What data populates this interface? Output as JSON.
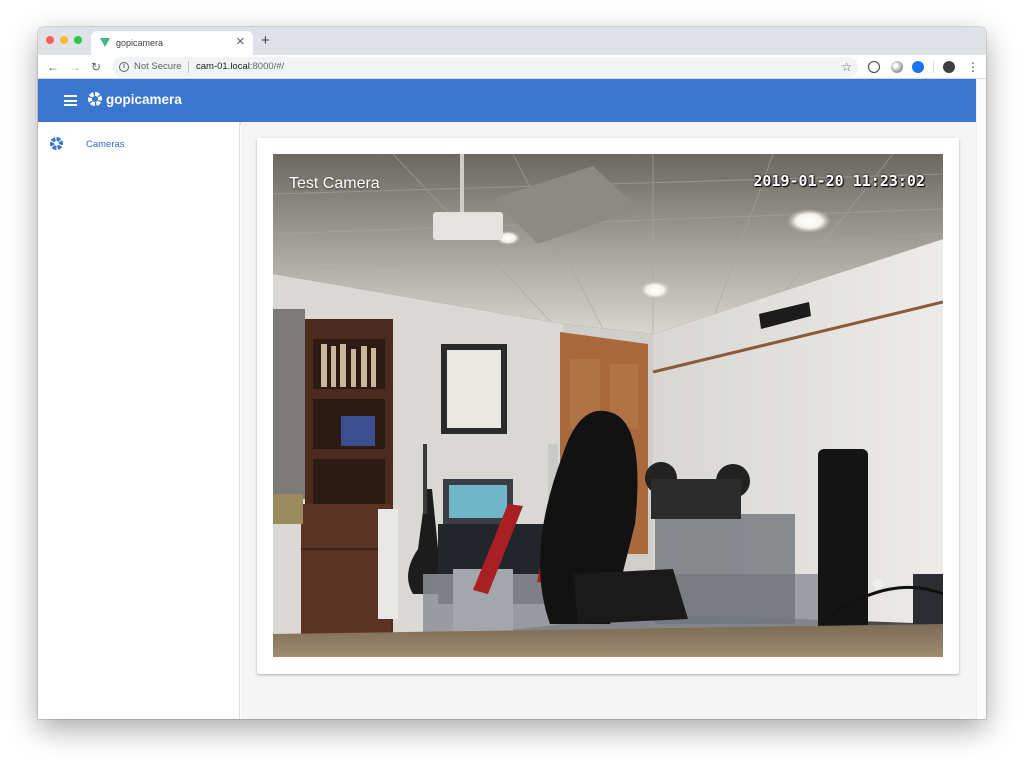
{
  "browser": {
    "tab_title": "gopicamera",
    "tab_favicon": "vue-logo-icon",
    "security_label": "Not Secure",
    "url_host": "cam-01.local",
    "url_rest": ":8000/#/"
  },
  "app": {
    "title": "gopicamera",
    "accent_color": "#3a76cf"
  },
  "sidebar": {
    "items": [
      {
        "label": "Cameras",
        "icon": "camera-aperture-icon"
      }
    ]
  },
  "main": {
    "camera": {
      "name": "Test Camera",
      "timestamp": "2019-01-20 11:23:02"
    }
  }
}
